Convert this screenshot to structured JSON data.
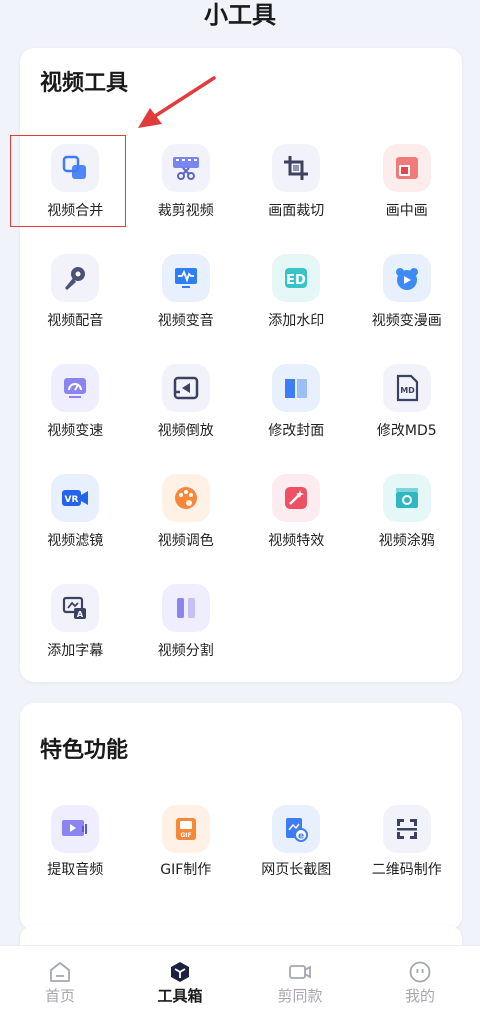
{
  "page_title": "小工具",
  "video_tools": {
    "title": "视频工具",
    "items": [
      {
        "label": "视频合并",
        "icon": "merge-icon"
      },
      {
        "label": "裁剪视频",
        "icon": "film-cut-icon"
      },
      {
        "label": "画面裁切",
        "icon": "crop-icon"
      },
      {
        "label": "画中画",
        "icon": "picture-in-picture-icon"
      },
      {
        "label": "视频配音",
        "icon": "microphone-icon"
      },
      {
        "label": "视频变音",
        "icon": "waveform-monitor-icon"
      },
      {
        "label": "添加水印",
        "icon": "watermark-icon"
      },
      {
        "label": "视频变漫画",
        "icon": "bear-play-icon"
      },
      {
        "label": "视频变速",
        "icon": "speedometer-icon"
      },
      {
        "label": "视频倒放",
        "icon": "rewind-play-icon"
      },
      {
        "label": "修改封面",
        "icon": "book-cover-icon"
      },
      {
        "label": "修改MD5",
        "icon": "md-file-icon"
      },
      {
        "label": "视频滤镜",
        "icon": "vr-camera-icon"
      },
      {
        "label": "视频调色",
        "icon": "palette-icon"
      },
      {
        "label": "视频特效",
        "icon": "magic-wand-icon"
      },
      {
        "label": "视频涂鸦",
        "icon": "clapperboard-icon"
      },
      {
        "label": "添加字幕",
        "icon": "subtitle-icon"
      },
      {
        "label": "视频分割",
        "icon": "split-icon"
      }
    ]
  },
  "features": {
    "title": "特色功能",
    "items": [
      {
        "label": "提取音频",
        "icon": "audio-extract-icon"
      },
      {
        "label": "GIF制作",
        "icon": "gif-icon",
        "badge": "GIF"
      },
      {
        "label": "网页长截图",
        "icon": "webpage-screenshot-icon"
      },
      {
        "label": "二维码制作",
        "icon": "qr-code-icon"
      }
    ]
  },
  "tabbar": {
    "tabs": [
      {
        "label": "首页",
        "icon": "home-icon",
        "active": false
      },
      {
        "label": "工具箱",
        "icon": "toolbox-icon",
        "active": true
      },
      {
        "label": "剪同款",
        "icon": "video-camera-icon",
        "active": false
      },
      {
        "label": "我的",
        "icon": "profile-icon",
        "active": false
      }
    ]
  },
  "colors": {
    "highlight": "#e23b3b",
    "primary_blue": "#3d7cf5",
    "active_tab": "#1a1a1a",
    "inactive_tab": "#a4a7b0"
  }
}
